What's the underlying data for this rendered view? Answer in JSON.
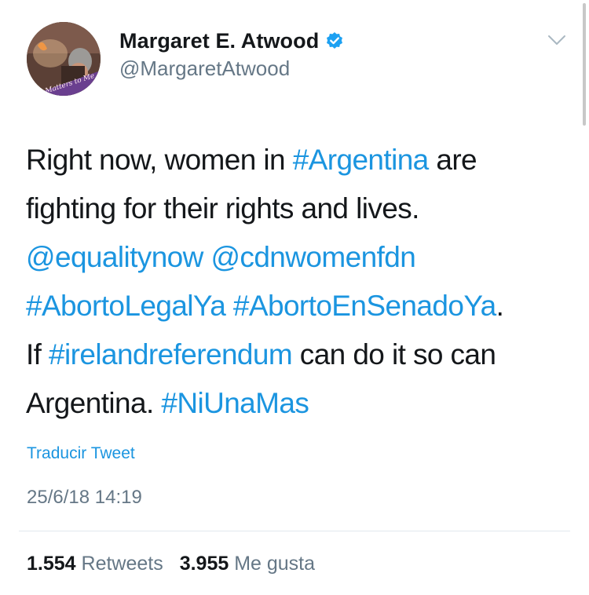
{
  "header": {
    "display_name": "Margaret E. Atwood",
    "handle": "@MargaretAtwood",
    "verified_icon": "verified-badge-icon",
    "menu_icon": "chevron-down-icon",
    "avatar_caption": "It Matters to Me"
  },
  "tweet": {
    "lines": [
      [
        {
          "t": "Right now, women in "
        },
        {
          "t": "#Argentina",
          "link": true
        },
        {
          "t": " are"
        }
      ],
      [
        {
          "t": "fighting for their rights and lives."
        }
      ],
      [
        {
          "t": "@equalitynow",
          "link": true
        },
        {
          "t": " "
        },
        {
          "t": "@cdnwomenfdn",
          "link": true
        }
      ],
      [
        {
          "t": "#AbortoLegalYa",
          "link": true
        },
        {
          "t": " "
        },
        {
          "t": "#AbortoEnSenadoYa",
          "link": true
        },
        {
          "t": "."
        }
      ],
      [
        {
          "t": "If "
        },
        {
          "t": "#irelandreferendum",
          "link": true
        },
        {
          "t": " can do it so can"
        }
      ],
      [
        {
          "t": "Argentina. "
        },
        {
          "t": "#NiUnaMas",
          "link": true
        }
      ]
    ],
    "translate_label": "Traducir Tweet",
    "timestamp": "25/6/18 14:19"
  },
  "stats": {
    "retweets_count": "1.554",
    "retweets_label": "Retweets",
    "likes_count": "3.955",
    "likes_label": "Me gusta"
  },
  "colors": {
    "link": "#1b95e0",
    "text": "#14171a",
    "muted": "#657786",
    "verified": "#1da1f2"
  }
}
